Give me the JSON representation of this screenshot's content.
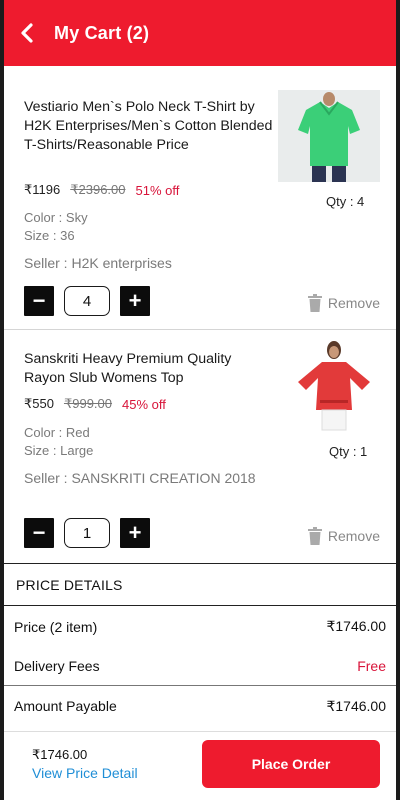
{
  "header": {
    "title": "My Cart (2)",
    "bg": "#ee1b2e"
  },
  "items": [
    {
      "title": "Vestiario Men`s Polo Neck T-Shirt by H2K Enterprises/Men`s Cotton Blended T-Shirts/Reasonable Price",
      "price": "₹1196",
      "mrp": "₹2396.00",
      "discount": "51% off",
      "color": "Color : Sky",
      "size": "Size : 36",
      "seller": "Seller : H2K enterprises",
      "qty_label": "Qty : 4",
      "qty_value": "4",
      "remove_label": "Remove",
      "image_icon": "green-polo-tshirt-image"
    },
    {
      "title": "Sanskriti Heavy Premium Quality Rayon  Slub Womens Top",
      "price": "₹550",
      "mrp": "₹999.00",
      "discount": "45% off",
      "color": "Color : Red",
      "size": "Size : Large",
      "seller": "Seller : SANSKRITI CREATION 2018",
      "qty_label": "Qty : 1",
      "qty_value": "1",
      "remove_label": "Remove",
      "image_icon": "red-womens-top-image"
    }
  ],
  "price_details": {
    "title": "PRICE DETAILS",
    "rows": [
      {
        "label": "Price (2 item)",
        "value": "₹1746.00"
      },
      {
        "label": "Delivery Fees",
        "value": "Free"
      },
      {
        "label": "Amount Payable",
        "value": "₹1746.00"
      }
    ]
  },
  "footer": {
    "total": "₹1746.00",
    "view_detail": "View Price Detail",
    "place_order": "Place Order"
  },
  "colors": {
    "accent": "#ee1b2e",
    "discount": "#d8143a",
    "link": "#1f8ed6"
  }
}
